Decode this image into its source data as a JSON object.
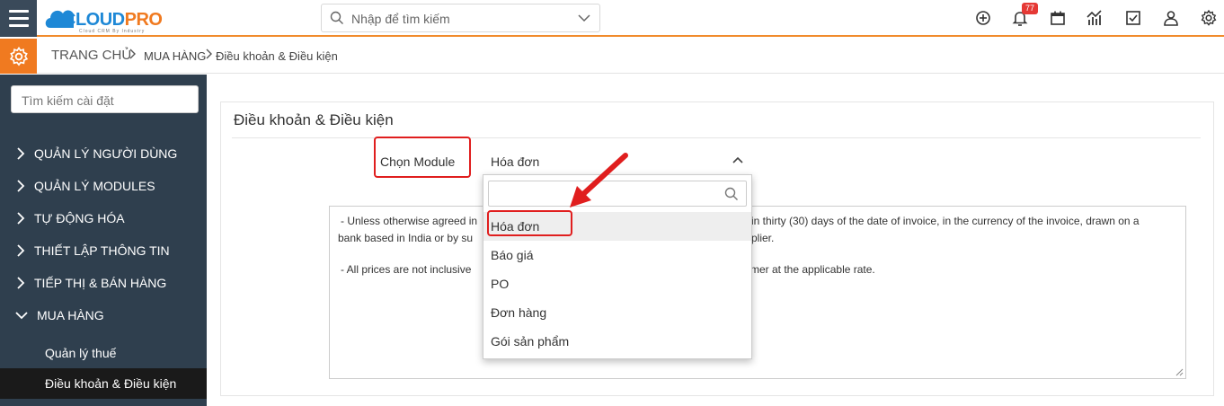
{
  "header": {
    "logo": {
      "brand_part1": "CLOUD",
      "brand_part2": "PRO",
      "tagline": "Cloud CRM By Industry"
    },
    "search_placeholder": "Nhập để tìm kiếm",
    "notification_count": "77",
    "icons": [
      "plus-circle-icon",
      "bell-icon",
      "calendar-icon",
      "chart-icon",
      "checkbox-icon",
      "user-icon",
      "gear-icon"
    ]
  },
  "breadcrumb": {
    "home": "TRANG CHỦ",
    "section": "MUA HÀNG",
    "current": "Điều khoản & Điều kiện"
  },
  "sidebar": {
    "search_placeholder": "Tìm kiếm cài đặt",
    "items": [
      {
        "label": "QUẢN LÝ NGƯỜI DÙNG",
        "expanded": false
      },
      {
        "label": "QUẢN LÝ MODULES",
        "expanded": false
      },
      {
        "label": "TỰ ĐỘNG HÓA",
        "expanded": false
      },
      {
        "label": "THIẾT LẬP THÔNG TIN",
        "expanded": false
      },
      {
        "label": "TIẾP THỊ & BÁN HÀNG",
        "expanded": false
      },
      {
        "label": "MUA HÀNG",
        "expanded": true
      }
    ],
    "subitems": [
      {
        "label": "Quản lý thuế",
        "active": false
      },
      {
        "label": "Điều khoản & Điều kiện",
        "active": true
      }
    ]
  },
  "main": {
    "title": "Điều khoản & Điều kiện",
    "module_label": "Chọn Module",
    "module_selected": "Hóa đơn",
    "dropdown_options": [
      "Hóa đơn",
      "Báo giá",
      "PO",
      "Đơn hàng",
      "Gói sản phẩm"
    ],
    "terms_line1_left": "- Unless otherwise agreed in",
    "terms_line1_right": "in thirty (30) days of the date of invoice, in the currency of the invoice, drawn on a",
    "terms_line2_left": "bank based in India or by su",
    "terms_line2_right": "plier.",
    "terms_line3_left": "- All prices are not inclusive",
    "terms_line3_right": "tomer at the applicable rate."
  },
  "colors": {
    "accent_orange": "#f07a20",
    "sidebar_bg": "#2f3f4e",
    "highlight_red": "#e01e1e",
    "logo_blue": "#1e88d6"
  }
}
